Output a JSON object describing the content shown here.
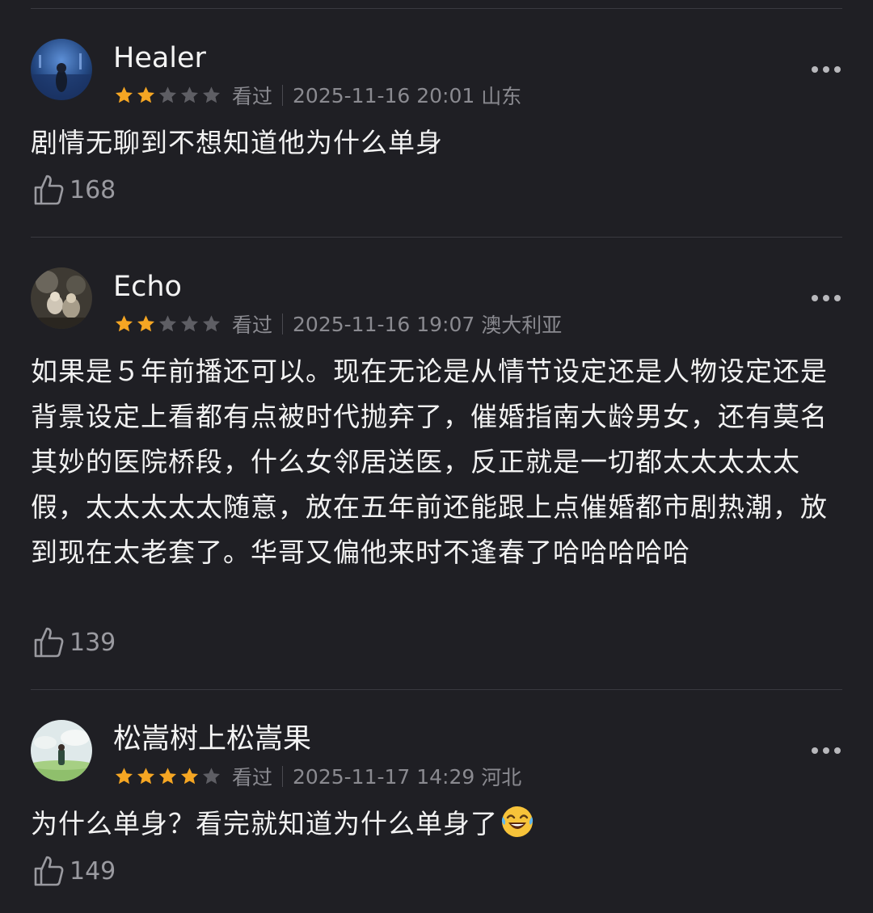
{
  "reviews": [
    {
      "username": "Healer",
      "rating": 2,
      "max_rating": 5,
      "status": "看过",
      "datetime": "2025-11-16 20:01",
      "location": "山东",
      "content": "剧情无聊到不想知道他为什么单身",
      "likes": "168"
    },
    {
      "username": "Echo",
      "rating": 2,
      "max_rating": 5,
      "status": "看过",
      "datetime": "2025-11-16 19:07",
      "location": "澳大利亚",
      "content": "如果是５年前播还可以。现在无论是从情节设定还是人物设定还是背景设定上看都有点被时代抛弃了，催婚指南大龄男女，还有莫名其妙的医院桥段，什么女邻居送医，反正就是一切都太太太太太假，太太太太太随意，放在五年前还能跟上点催婚都市剧热潮，放到现在太老套了。华哥又偏他来时不逢春了哈哈哈哈哈",
      "likes": "139"
    },
    {
      "username": "松嵩树上松嵩果",
      "rating": 4,
      "max_rating": 5,
      "status": "看过",
      "datetime": "2025-11-17 14:29",
      "location": "河北",
      "content": "为什么单身？看完就知道为什么单身了",
      "emoji": "😂",
      "likes": "149"
    }
  ],
  "colors": {
    "background": "#1f1f24",
    "star_filled": "#f5a623",
    "star_empty": "#5e5e64",
    "meta_text": "#8a8a90"
  },
  "icons": {
    "like": "thumbs-up-icon",
    "more": "more-horizontal-icon",
    "star": "star-icon"
  }
}
